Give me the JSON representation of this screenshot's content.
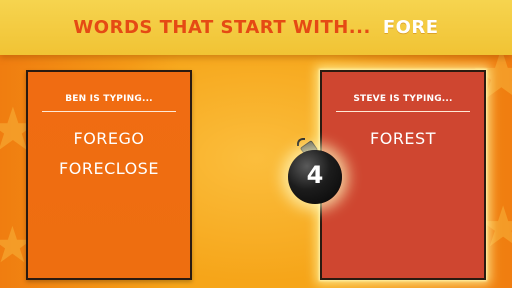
{
  "prompt": {
    "label": "WORDS THAT START WITH...",
    "word": "FORE"
  },
  "players": [
    {
      "status": "BEN IS TYPING...",
      "words": [
        "FOREGO",
        "FORECLOSE"
      ],
      "active": false
    },
    {
      "status": "STEVE IS TYPING...",
      "words": [
        "FOREST"
      ],
      "active": true
    }
  ],
  "bomb": {
    "countdown": "4"
  },
  "colors": {
    "banner": "#f1c334",
    "prompt_label": "#e54a14",
    "left_panel": "#ee6e10",
    "right_panel": "#cf4630",
    "background": "#f6a519"
  }
}
